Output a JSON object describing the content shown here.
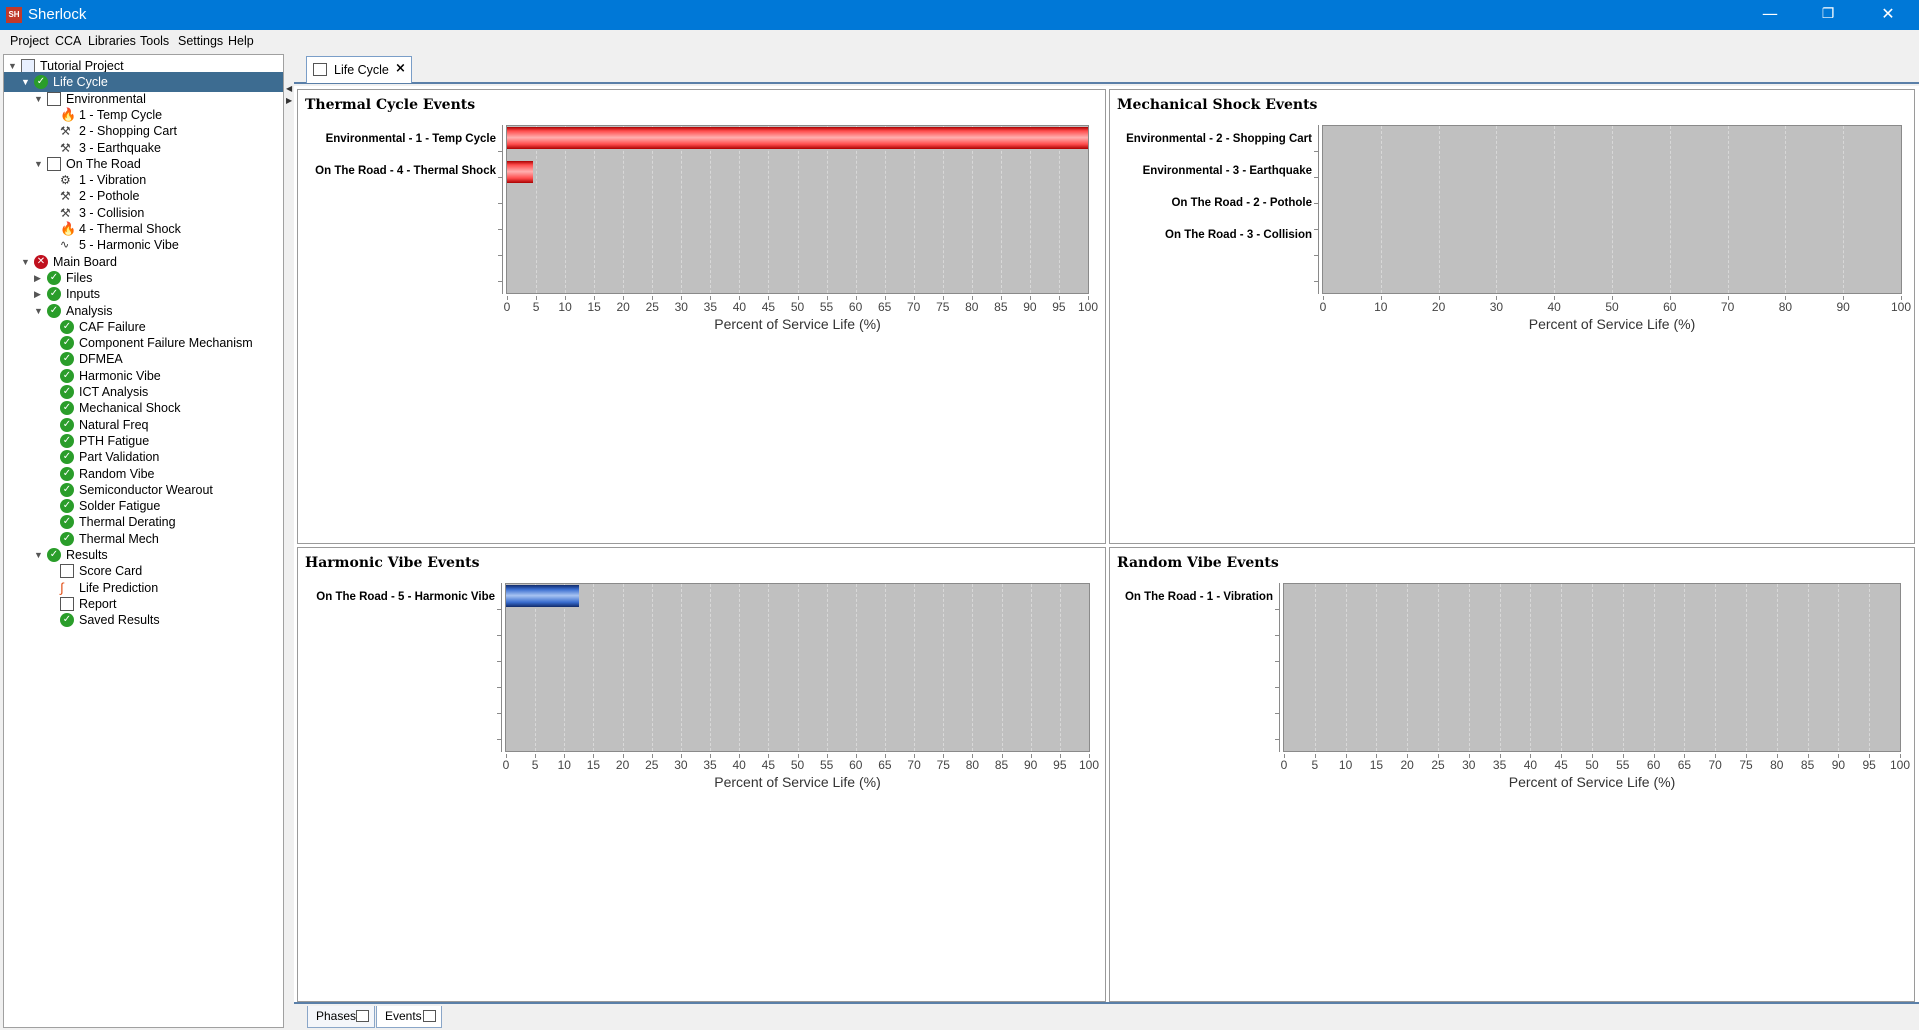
{
  "app": {
    "title": "Sherlock",
    "icon_text": "SH"
  },
  "window_controls": {
    "minimize": "—",
    "maximize": "❐",
    "close": "✕"
  },
  "menu": [
    "Project",
    "CCA",
    "Libraries",
    "Tools",
    "Settings",
    "Help"
  ],
  "tree": [
    {
      "label": "Tutorial Project",
      "level": 0,
      "icon": "folder-icon",
      "toggle": "▼"
    },
    {
      "label": "Life Cycle",
      "level": 1,
      "icon": "check-icon",
      "toggle": "▼",
      "selected": true
    },
    {
      "label": "Environmental",
      "level": 2,
      "icon": "calendar-icon",
      "toggle": "▼"
    },
    {
      "label": "1 - Temp Cycle",
      "level": 3,
      "icon": "fire-icon"
    },
    {
      "label": "2 - Shopping Cart",
      "level": 3,
      "icon": "hammer-icon"
    },
    {
      "label": "3 - Earthquake",
      "level": 3,
      "icon": "hammer-icon"
    },
    {
      "label": "On The Road",
      "level": 2,
      "icon": "calendar-icon",
      "toggle": "▼"
    },
    {
      "label": "1 - Vibration",
      "level": 3,
      "icon": "vibration-icon"
    },
    {
      "label": "2 - Pothole",
      "level": 3,
      "icon": "hammer-icon"
    },
    {
      "label": "3 - Collision",
      "level": 3,
      "icon": "hammer-icon"
    },
    {
      "label": "4 - Thermal Shock",
      "level": 3,
      "icon": "fire-icon"
    },
    {
      "label": "5 - Harmonic Vibe",
      "level": 3,
      "icon": "wave-icon"
    },
    {
      "label": "Main Board",
      "level": 1,
      "icon": "error-icon",
      "toggle": "▼"
    },
    {
      "label": "Files",
      "level": 2,
      "icon": "check-icon",
      "toggle": "▶"
    },
    {
      "label": "Inputs",
      "level": 2,
      "icon": "check-icon",
      "toggle": "▶"
    },
    {
      "label": "Analysis",
      "level": 2,
      "icon": "check-icon",
      "toggle": "▼"
    },
    {
      "label": "CAF Failure",
      "level": 3,
      "icon": "check-icon"
    },
    {
      "label": "Component Failure Mechanism",
      "level": 3,
      "icon": "check-icon"
    },
    {
      "label": "DFMEA",
      "level": 3,
      "icon": "check-icon"
    },
    {
      "label": "Harmonic Vibe",
      "level": 3,
      "icon": "check-icon"
    },
    {
      "label": "ICT Analysis",
      "level": 3,
      "icon": "check-icon"
    },
    {
      "label": "Mechanical Shock",
      "level": 3,
      "icon": "check-icon"
    },
    {
      "label": "Natural Freq",
      "level": 3,
      "icon": "check-icon"
    },
    {
      "label": "PTH Fatigue",
      "level": 3,
      "icon": "check-icon"
    },
    {
      "label": "Part Validation",
      "level": 3,
      "icon": "check-icon"
    },
    {
      "label": "Random Vibe",
      "level": 3,
      "icon": "check-icon"
    },
    {
      "label": "Semiconductor Wearout",
      "level": 3,
      "icon": "check-icon"
    },
    {
      "label": "Solder Fatigue",
      "level": 3,
      "icon": "check-icon"
    },
    {
      "label": "Thermal Derating",
      "level": 3,
      "icon": "check-icon"
    },
    {
      "label": "Thermal Mech",
      "level": 3,
      "icon": "check-icon"
    },
    {
      "label": "Results",
      "level": 2,
      "icon": "check-icon",
      "toggle": "▼"
    },
    {
      "label": "Score Card",
      "level": 3,
      "icon": "table-icon"
    },
    {
      "label": "Life Prediction",
      "level": 3,
      "icon": "curve-icon"
    },
    {
      "label": "Report",
      "level": 3,
      "icon": "pdf-icon"
    },
    {
      "label": "Saved Results",
      "level": 3,
      "icon": "check-icon"
    }
  ],
  "tab": {
    "label": "Life Cycle",
    "close": "×"
  },
  "bottom_tabs": [
    {
      "label": "Phases"
    },
    {
      "label": "Events",
      "active": true
    }
  ],
  "colors": {
    "accent": "#0078d7",
    "plot_bg": "#c0c0c0",
    "thermal_bar": "#ff4d4d",
    "harmonic_bar": "#3a6ed0"
  },
  "chart_data": [
    {
      "type": "bar",
      "orientation": "horizontal",
      "title": "Thermal Cycle Events",
      "categories": [
        "Environmental - 1 - Temp Cycle",
        "On The Road - 4 - Thermal Shock"
      ],
      "values": [
        100,
        4.5
      ],
      "xlabel": "Percent of Service Life (%)",
      "xlim": [
        0,
        100
      ],
      "xticks": [
        0,
        5,
        10,
        15,
        20,
        25,
        30,
        35,
        40,
        45,
        50,
        55,
        60,
        65,
        70,
        75,
        80,
        85,
        90,
        95,
        100
      ],
      "bar_color": "red"
    },
    {
      "type": "bar",
      "orientation": "horizontal",
      "title": "Mechanical Shock Events",
      "categories": [
        "Environmental - 2 - Shopping Cart",
        "Environmental - 3 - Earthquake",
        "On The Road - 2 - Pothole",
        "On The Road - 3 - Collision"
      ],
      "values": [
        0,
        0,
        0,
        0
      ],
      "xlabel": "Percent of Service Life (%)",
      "xlim": [
        0,
        100
      ],
      "xticks": [
        0,
        10,
        20,
        30,
        40,
        50,
        60,
        70,
        80,
        90,
        100
      ],
      "bar_color": "red"
    },
    {
      "type": "bar",
      "orientation": "horizontal",
      "title": "Harmonic Vibe Events",
      "categories": [
        "On The Road - 5 - Harmonic Vibe"
      ],
      "values": [
        12.5
      ],
      "xlabel": "Percent of Service Life (%)",
      "xlim": [
        0,
        100
      ],
      "xticks": [
        0,
        5,
        10,
        15,
        20,
        25,
        30,
        35,
        40,
        45,
        50,
        55,
        60,
        65,
        70,
        75,
        80,
        85,
        90,
        95,
        100
      ],
      "bar_color": "blue"
    },
    {
      "type": "bar",
      "orientation": "horizontal",
      "title": "Random Vibe Events",
      "categories": [
        "On The Road - 1 - Vibration"
      ],
      "values": [
        0
      ],
      "xlabel": "Percent of Service Life (%)",
      "xlim": [
        0,
        100
      ],
      "xticks": [
        0,
        5,
        10,
        15,
        20,
        25,
        30,
        35,
        40,
        45,
        50,
        55,
        60,
        65,
        70,
        75,
        80,
        85,
        90,
        95,
        100
      ],
      "bar_color": "blue"
    }
  ]
}
